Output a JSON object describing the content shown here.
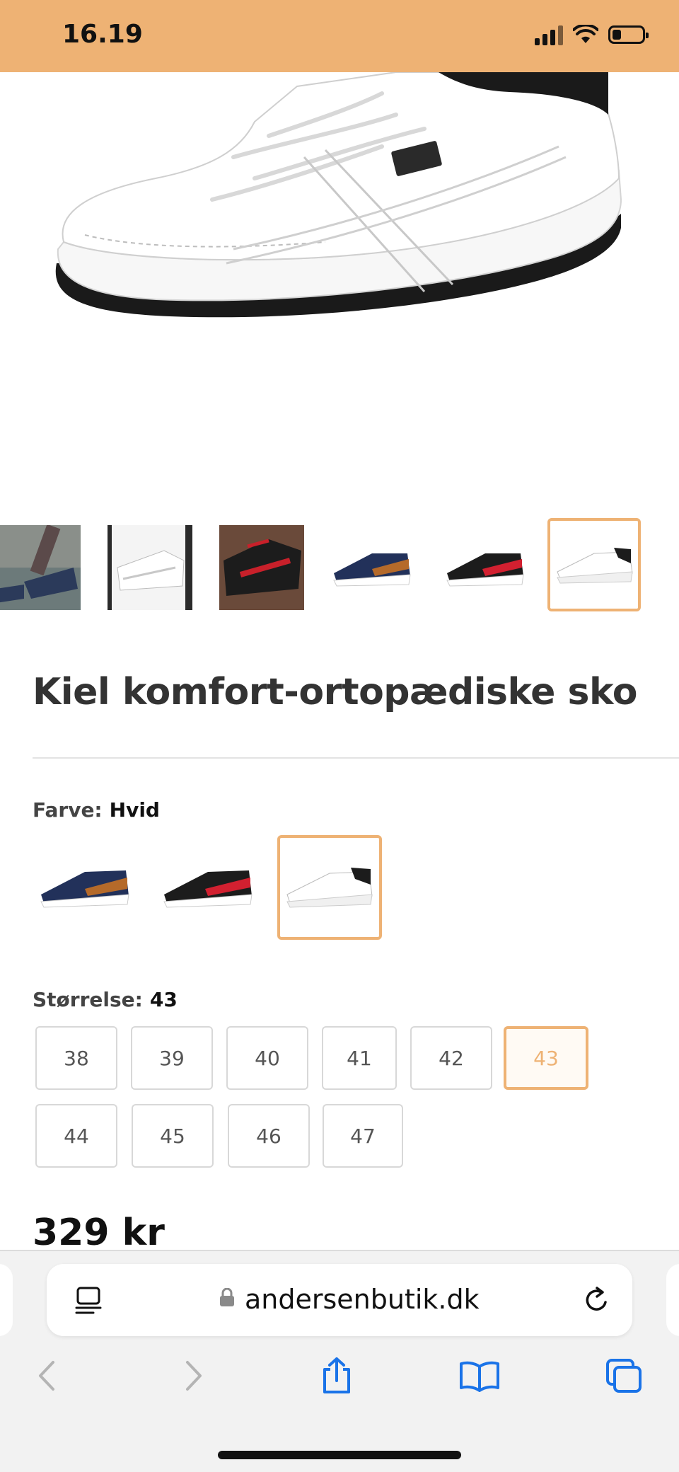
{
  "status_bar": {
    "time": "16.19"
  },
  "product": {
    "title": "Kiel komfort-ortopædiske sko",
    "price": "329 kr",
    "gallery_selected_index": 5,
    "gallery_images": [
      "person-walking-blue-sneakers",
      "white-sneakers-held",
      "black-red-sneakers-held",
      "blue-sneaker",
      "black-red-sneaker",
      "white-sneaker"
    ]
  },
  "color_option": {
    "label": "Farve:",
    "value": "Hvid",
    "swatches": [
      "blue-sneaker",
      "black-red-sneaker",
      "white-sneaker"
    ],
    "selected_index": 2
  },
  "size_option": {
    "label": "Størrelse:",
    "value": "43",
    "sizes": [
      "38",
      "39",
      "40",
      "41",
      "42",
      "43",
      "44",
      "45",
      "46",
      "47"
    ],
    "selected": "43"
  },
  "browser": {
    "url": "andersenbutik.dk"
  },
  "colors": {
    "accent": "#eeb274",
    "text": "#333333"
  }
}
